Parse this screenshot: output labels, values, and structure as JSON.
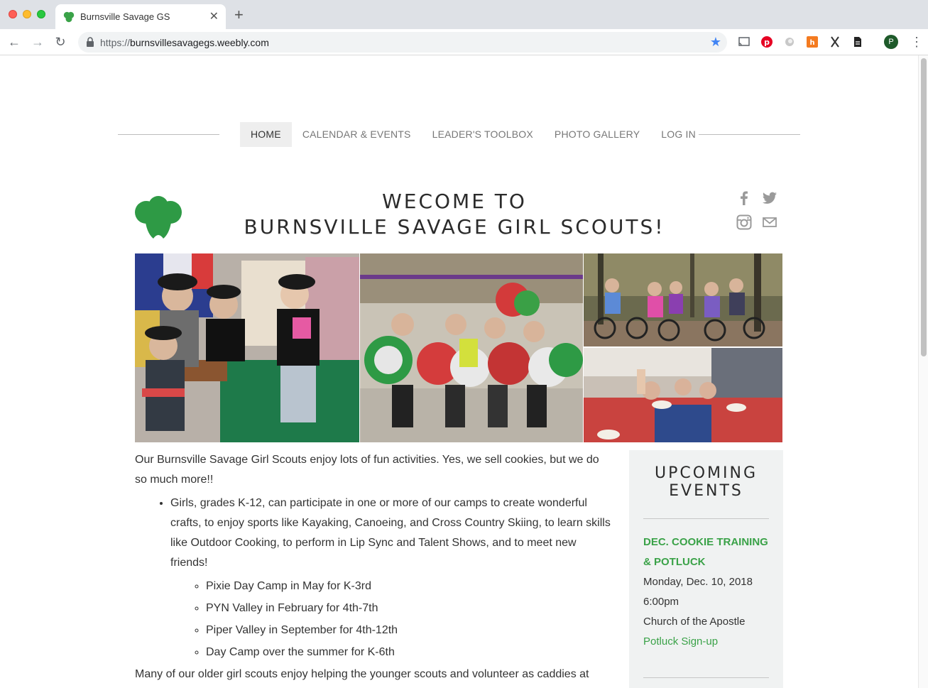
{
  "browser": {
    "tab_title": "Burnsville Savage GS",
    "url_scheme": "https://",
    "url_host": "burnsvillesavagegs.weebly.com",
    "profile_initial": "P"
  },
  "nav": {
    "items": [
      {
        "label": "HOME",
        "active": true
      },
      {
        "label": "CALENDAR & EVENTS",
        "active": false
      },
      {
        "label": "LEADER'S TOOLBOX",
        "active": false
      },
      {
        "label": "PHOTO GALLERY",
        "active": false
      },
      {
        "label": "LOG IN",
        "active": false
      }
    ]
  },
  "header": {
    "line1": "WECOME TO",
    "line2": "BURNSVILLE SAVAGE GIRL SCOUTS!"
  },
  "social": [
    "facebook-icon",
    "twitter-icon",
    "instagram-icon",
    "mail-icon"
  ],
  "photos": [
    "cookie-booth-photo",
    "ornament-craft-photo",
    "bike-ride-photo",
    "sleepover-photo"
  ],
  "intro": {
    "paragraph": "Our Burnsville Savage Girl Scouts enjoy lots of fun activities. Yes, we sell cookies, but we do so much more!!",
    "bullet": "Girls, grades K-12, can participate in one or more of our camps to create wonderful crafts, to enjoy sports like Kayaking, Canoeing, and Cross Country Skiing, to learn skills like Outdoor Cooking, to perform in Lip Sync and Talent Shows, and to meet new friends!",
    "camps": [
      "Pixie Day Camp in May for K-3rd",
      "PYN Valley in February for 4th-7th",
      "Piper Valley in September for 4th-12th",
      "Day Camp over the summer for K-6th"
    ],
    "paragraph2": "Many of our older girl scouts enjoy helping the younger scouts and volunteer as caddies at"
  },
  "sidebar": {
    "title_line1": "UPCOMING",
    "title_line2": "EVENTS",
    "event": {
      "title_line1": "DEC. COOKIE TRAINING",
      "title_line2": "& POTLUCK",
      "date": "Monday, Dec. 10, 2018",
      "time": "6:00pm",
      "location": "Church of the Apostle",
      "link": "Potluck Sign-up"
    }
  },
  "colors": {
    "brand_green": "#3aa248",
    "trefoil_green": "#2e9a45"
  }
}
